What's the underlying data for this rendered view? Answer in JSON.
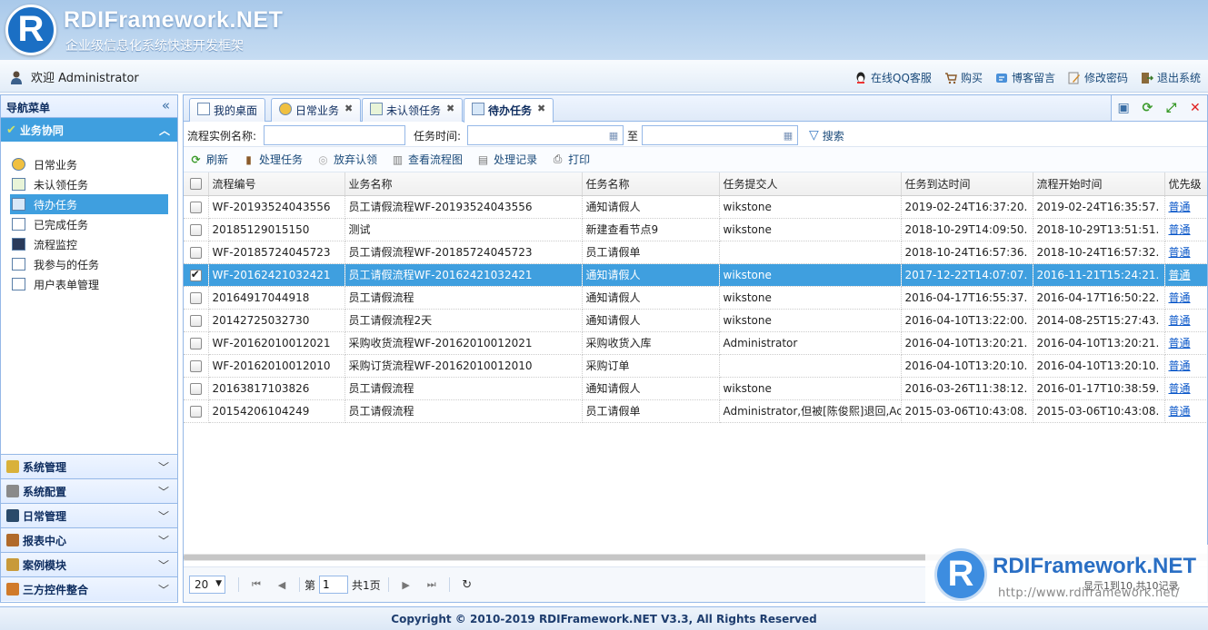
{
  "banner": {
    "logo_letter": "R",
    "title": "RDIFramework.NET",
    "subtitle": "企业级信息化系统快速开发框架"
  },
  "userbar": {
    "welcome": "欢迎 Administrator",
    "links": [
      "在线QQ客服",
      "购买",
      "博客留言",
      "修改密码",
      "退出系统"
    ]
  },
  "sidebar": {
    "header": "导航菜单",
    "collapse_icon": "«",
    "active_group": "业务协同",
    "items": [
      "日常业务",
      "未认领任务",
      "待办任务",
      "已完成任务",
      "流程监控",
      "我参与的任务",
      "用户表单管理"
    ],
    "selected_index": 2,
    "groups": [
      "系统管理",
      "系统配置",
      "日常管理",
      "报表中心",
      "案例模块",
      "三方控件整合"
    ]
  },
  "tabs": [
    {
      "label": "我的桌面",
      "closable": false
    },
    {
      "label": "日常业务",
      "closable": true
    },
    {
      "label": "未认领任务",
      "closable": true
    },
    {
      "label": "待办任务",
      "closable": true,
      "active": true
    }
  ],
  "search": {
    "instance_label": "流程实例名称:",
    "instance_value": "",
    "time_label": "任务时间:",
    "time_from": "",
    "to_label": "至",
    "time_to": "",
    "search_button": "搜索"
  },
  "toolbar": [
    "刷新",
    "处理任务",
    "放弃认领",
    "查看流程图",
    "处理记录",
    "打印"
  ],
  "grid": {
    "columns": [
      "流程编号",
      "业务名称",
      "任务名称",
      "任务提交人",
      "任务到达时间",
      "流程开始时间",
      "优先级"
    ],
    "rows": [
      [
        "WF-20193524043556",
        "员工请假流程WF-20193524043556",
        "通知请假人",
        "wikstone",
        "2019-02-24T16:37:20.",
        "2019-02-24T16:35:57.",
        "普通"
      ],
      [
        "20185129015150",
        "测试",
        "新建查看节点9",
        "wikstone",
        "2018-10-29T14:09:50.",
        "2018-10-29T13:51:51.",
        "普通"
      ],
      [
        "WF-20185724045723",
        "员工请假流程WF-20185724045723",
        "员工请假单",
        "",
        "2018-10-24T16:57:36.",
        "2018-10-24T16:57:32.",
        "普通"
      ],
      [
        "WF-20162421032421",
        "员工请假流程WF-20162421032421",
        "通知请假人",
        "wikstone",
        "2017-12-22T14:07:07.",
        "2016-11-21T15:24:21.",
        "普通"
      ],
      [
        "20164917044918",
        "员工请假流程",
        "通知请假人",
        "wikstone",
        "2016-04-17T16:55:37.",
        "2016-04-17T16:50:22.",
        "普通"
      ],
      [
        "20142725032730",
        "员工请假流程2天",
        "通知请假人",
        "wikstone",
        "2016-04-10T13:22:00.",
        "2014-08-25T15:27:43.",
        "普通"
      ],
      [
        "WF-20162010012021",
        "采购收货流程WF-20162010012021",
        "采购收货入库",
        "Administrator",
        "2016-04-10T13:20:21.",
        "2016-04-10T13:20:21.",
        "普通"
      ],
      [
        "WF-20162010012010",
        "采购订货流程WF-20162010012010",
        "采购订单",
        "",
        "2016-04-10T13:20:10.",
        "2016-04-10T13:20:10.",
        "普通"
      ],
      [
        "20163817103826",
        "员工请假流程",
        "通知请假人",
        "wikstone",
        "2016-03-26T11:38:12.",
        "2016-01-17T10:38:59.",
        "普通"
      ],
      [
        "20154206104249",
        "员工请假流程",
        "员工请假单",
        "Administrator,但被[陈俊熙]退回,Ac",
        "2015-03-06T10:43:08.",
        "2015-03-06T10:43:08.",
        "普通"
      ]
    ],
    "selected_row": 3
  },
  "pager": {
    "page_size": "20",
    "page_prefix": "第",
    "page_value": "1",
    "page_suffix": "共1页"
  },
  "watermark": {
    "title": "RDIFramework.NET",
    "records": "显示1到10,共10记录",
    "url": "http://www.rdiframework.net/"
  },
  "footer": "Copyright © 2010-2019 RDIFramework.NET V3.3, All Rights Reserved",
  "colors": {
    "accent": "#3f9fdf",
    "border": "#95b8e7",
    "banner": "#a9c9ea"
  }
}
